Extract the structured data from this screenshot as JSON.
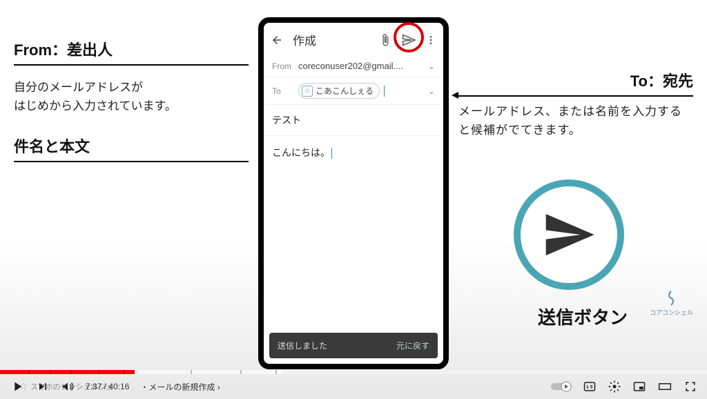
{
  "annotations": {
    "from": {
      "title": "From：差出人",
      "desc": "自分のメールアドレスが\nはじめから入力されています。"
    },
    "subject_body": {
      "title": "件名と本文"
    },
    "to": {
      "title": "To：宛先",
      "desc": "メールアドレス、または名前を入力すると候補がでてきます。"
    },
    "send_button_label": "送信ボタン"
  },
  "phone": {
    "compose_title": "作成",
    "from_label": "From",
    "from_value": "coreconuser202@gmail....",
    "to_label": "To",
    "to_chip": "こあこんしぇる",
    "subject": "テスト",
    "body": "こんにちは。",
    "toast_msg": "送信しました",
    "toast_undo": "元に戻す"
  },
  "brand_small": "コアコンシェル",
  "player": {
    "time_current": "7:37",
    "time_total": "40:16",
    "chapter_title": "メールの新規作成",
    "bottom_brand": "スマホのコンシェルジュ"
  }
}
